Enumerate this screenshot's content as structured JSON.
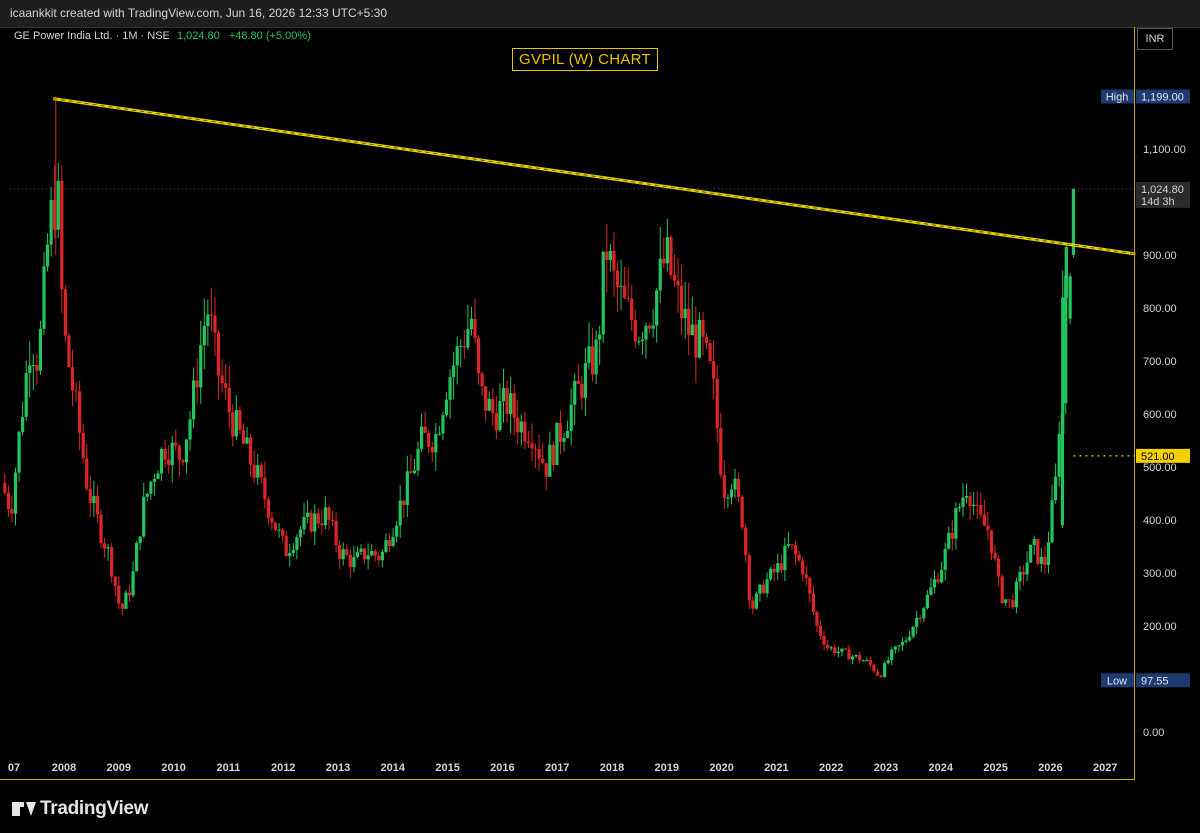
{
  "topbar": {
    "credit": "icaankkit created with TradingView.com, Jun 16, 2026 12:33 UTC+5:30"
  },
  "symbol": {
    "name_line": "GE Power India Ltd. · 1M · NSE",
    "price": "1,024.80",
    "change": "+48.80 (+5.00%)"
  },
  "currency_label": "INR",
  "footer": {
    "brand": "TradingView"
  },
  "colors": {
    "up": "#22c55e",
    "down": "#dc2626",
    "trend": "#e6d200",
    "hl_badge": "#1e3a6e",
    "marker": "#f5d000"
  },
  "chart_data": {
    "type": "candlestick",
    "title": "GVPIL (W) CHART",
    "interval": "1M",
    "x_ticks": [
      "07",
      "2008",
      "2009",
      "2010",
      "2011",
      "2012",
      "2013",
      "2014",
      "2015",
      "2016",
      "2017",
      "2018",
      "2019",
      "2020",
      "2021",
      "2022",
      "2023",
      "2024",
      "2025",
      "2026",
      "2027"
    ],
    "y_ticks": [
      "0.00",
      "200.00",
      "300.00",
      "400.00",
      "500.00",
      "600.00",
      "700.00",
      "800.00",
      "900.00",
      "1,100.00"
    ],
    "ylim": [
      -20,
      1260
    ],
    "badges": {
      "high": {
        "label": "High",
        "value": "1,199.00",
        "price": 1199
      },
      "low": {
        "label": "Low",
        "value": "97.55",
        "price": 97.55
      },
      "last": {
        "value": "1,024.80",
        "countdown": "14d 3h",
        "price": 1024.8
      },
      "marker": {
        "value": "521.00",
        "price": 521
      }
    },
    "trendline": {
      "from": {
        "year": 2007.8,
        "price": 1195
      },
      "to": {
        "year": 2027.55,
        "price": 902
      }
    },
    "waypoints": [
      [
        2006.92,
        470
      ],
      [
        2007.1,
        420
      ],
      [
        2007.25,
        560
      ],
      [
        2007.45,
        740
      ],
      [
        2007.6,
        700
      ],
      [
        2007.8,
        960
      ],
      [
        2007.95,
        1020
      ],
      [
        2008.05,
        760
      ],
      [
        2008.3,
        600
      ],
      [
        2008.5,
        460
      ],
      [
        2008.7,
        390
      ],
      [
        2008.9,
        330
      ],
      [
        2009.1,
        225
      ],
      [
        2009.3,
        280
      ],
      [
        2009.5,
        420
      ],
      [
        2009.7,
        490
      ],
      [
        2009.9,
        540
      ],
      [
        2010.2,
        520
      ],
      [
        2010.4,
        610
      ],
      [
        2010.6,
        760
      ],
      [
        2010.7,
        800
      ],
      [
        2010.85,
        690
      ],
      [
        2011.1,
        600
      ],
      [
        2011.35,
        540
      ],
      [
        2011.6,
        480
      ],
      [
        2011.85,
        410
      ],
      [
        2012.1,
        340
      ],
      [
        2012.35,
        380
      ],
      [
        2012.6,
        400
      ],
      [
        2012.85,
        410
      ],
      [
        2013.1,
        340
      ],
      [
        2013.35,
        320
      ],
      [
        2013.6,
        340
      ],
      [
        2013.85,
        330
      ],
      [
        2014.1,
        400
      ],
      [
        2014.35,
        470
      ],
      [
        2014.6,
        550
      ],
      [
        2014.85,
        560
      ],
      [
        2015.05,
        660
      ],
      [
        2015.3,
        730
      ],
      [
        2015.5,
        780
      ],
      [
        2015.65,
        640
      ],
      [
        2015.9,
        600
      ],
      [
        2016.15,
        620
      ],
      [
        2016.4,
        580
      ],
      [
        2016.6,
        570
      ],
      [
        2016.85,
        500
      ],
      [
        2017.1,
        560
      ],
      [
        2017.35,
        620
      ],
      [
        2017.6,
        680
      ],
      [
        2017.8,
        720
      ],
      [
        2017.95,
        920
      ],
      [
        2018.1,
        850
      ],
      [
        2018.3,
        800
      ],
      [
        2018.55,
        760
      ],
      [
        2018.8,
        800
      ],
      [
        2019.05,
        900
      ],
      [
        2019.25,
        820
      ],
      [
        2019.45,
        760
      ],
      [
        2019.7,
        730
      ],
      [
        2019.9,
        660
      ],
      [
        2020.1,
        460
      ],
      [
        2020.25,
        480
      ],
      [
        2020.45,
        400
      ],
      [
        2020.6,
        230
      ],
      [
        2020.85,
        280
      ],
      [
        2021.1,
        310
      ],
      [
        2021.3,
        350
      ],
      [
        2021.55,
        310
      ],
      [
        2021.8,
        200
      ],
      [
        2022.0,
        160
      ],
      [
        2022.25,
        150
      ],
      [
        2022.55,
        140
      ],
      [
        2022.75,
        130
      ],
      [
        2022.95,
        105
      ],
      [
        2023.15,
        145
      ],
      [
        2023.4,
        170
      ],
      [
        2023.65,
        220
      ],
      [
        2023.85,
        260
      ],
      [
        2024.1,
        320
      ],
      [
        2024.35,
        410
      ],
      [
        2024.55,
        470
      ],
      [
        2024.75,
        400
      ],
      [
        2024.95,
        380
      ],
      [
        2025.15,
        260
      ],
      [
        2025.35,
        240
      ],
      [
        2025.55,
        300
      ],
      [
        2025.75,
        350
      ],
      [
        2025.95,
        310
      ],
      [
        2026.1,
        420
      ],
      [
        2026.2,
        500
      ],
      [
        2026.3,
        850
      ],
      [
        2026.42,
        1024.8
      ]
    ],
    "series_note": "GE Power India Ltd. OHLC"
  }
}
